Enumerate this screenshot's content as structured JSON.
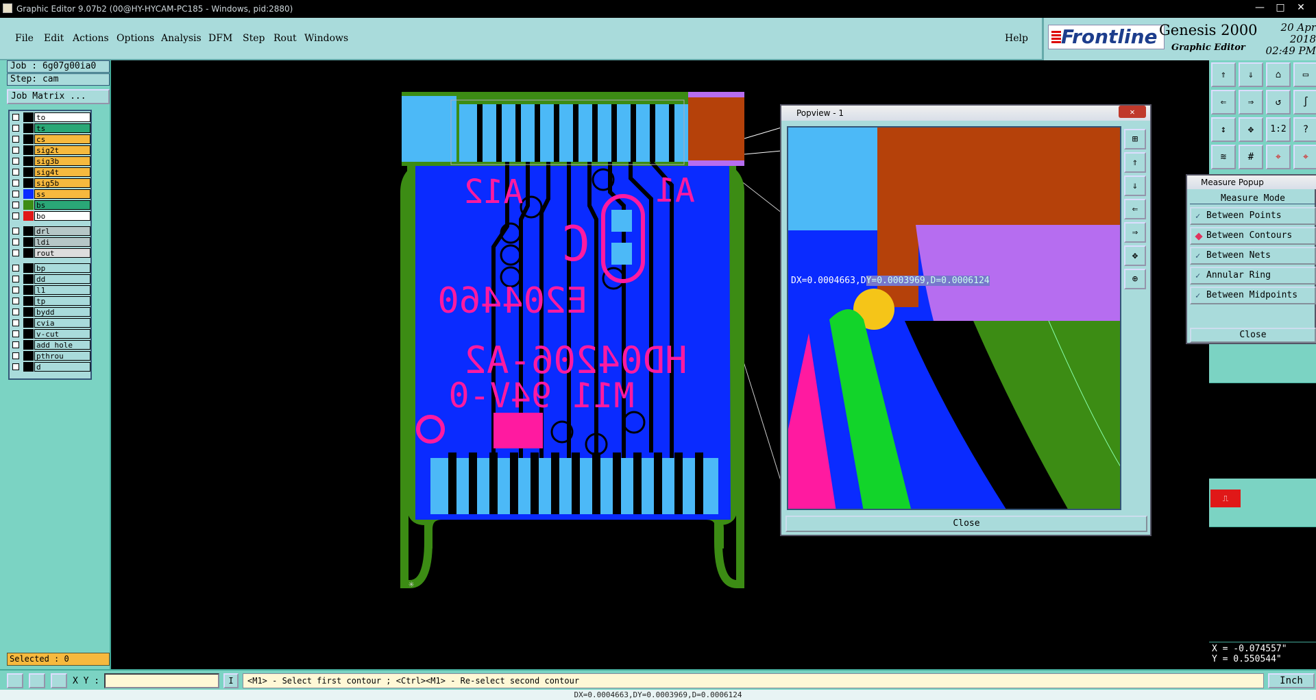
{
  "window": {
    "title": "Graphic Editor 9.07b2 (00@HY-HYCAM-PC185 - Windows, pid:2880)"
  },
  "menubar": {
    "items": [
      "File",
      "Edit",
      "Actions",
      "Options",
      "Analysis",
      "DFM",
      "Step",
      "Rout",
      "Windows"
    ],
    "help": "Help"
  },
  "brand": {
    "logo": "Frontline",
    "product": "Genesis 2000",
    "subtitle": "Graphic Editor",
    "date": "20 Apr 2018",
    "time": "02:49 PM"
  },
  "job": {
    "job": "Job : 6g07g00ia0",
    "step": "Step: cam",
    "matrix": "Job Matrix ..."
  },
  "layers": [
    {
      "name": "to",
      "color": "#ffffff"
    },
    {
      "name": "ts",
      "color": "#2aa877"
    },
    {
      "name": "cs",
      "color": "#f6b93e"
    },
    {
      "name": "sig2t",
      "color": "#f6b93e"
    },
    {
      "name": "sig3b",
      "color": "#f6b93e"
    },
    {
      "name": "sig4t",
      "color": "#f6b93e"
    },
    {
      "name": "sig5b",
      "color": "#f6b93e"
    },
    {
      "name": "ss",
      "color": "#f6b93e"
    },
    {
      "name": "bs",
      "color": "#2aa877"
    },
    {
      "name": "bo",
      "color": "#ffffff"
    },
    {
      "name": "drl",
      "color": "#b6c7c7"
    },
    {
      "name": "ldi",
      "color": "#b6c7c7"
    },
    {
      "name": "rout",
      "color": "#dddddd"
    },
    {
      "name": "bp",
      "color": "#a9dbdb"
    },
    {
      "name": "dd",
      "color": "#a9dbdb"
    },
    {
      "name": "l1",
      "color": "#a9dbdb"
    },
    {
      "name": "tp",
      "color": "#a9dbdb"
    },
    {
      "name": "bydd",
      "color": "#a9dbdb"
    },
    {
      "name": "cvia",
      "color": "#a9dbdb"
    },
    {
      "name": "v-cut",
      "color": "#a9dbdb"
    },
    {
      "name": "add_hole",
      "color": "#a9dbdb"
    },
    {
      "name": "pthrou",
      "color": "#a9dbdb"
    },
    {
      "name": "d",
      "color": "#a9dbdb"
    }
  ],
  "selected": "Selected : 0",
  "board_text": {
    "a12": "A12",
    "a1": "A1",
    "c": "C",
    "code1": "E204460",
    "code2": "HD04206-A2",
    "code3": "M11 94V-0"
  },
  "popview": {
    "title": "Popview - 1",
    "close": "Close",
    "measure_prefix": "DX=0.0004663,D",
    "measure_highlight": "Y=0.0003969,D=0.0006124"
  },
  "measure_popup": {
    "title": "Measure Popup",
    "mode_label": "Measure Mode",
    "options": [
      "Between Points",
      "Between Contours",
      "Between Nets",
      "Annular Ring",
      "Between Midpoints"
    ],
    "selected": "Between Contours",
    "close": "Close"
  },
  "coords": {
    "x": "X = -0.074557\"",
    "y": "Y = 0.550544\""
  },
  "statusbar": {
    "xy_label": "X Y :",
    "xy_value": "",
    "message": "<M1> - Select first contour ; <Ctrl><M1> - Re-select second contour",
    "unit": "Inch"
  },
  "bottom_text": "DX=0.0004663,DY=0.0003969,D=0.0006124",
  "colors": {
    "panel": "#7bd3c3",
    "light": "#a9dbdb",
    "board_blue": "#0a2bff",
    "copper": "#4cb9f7",
    "silk": "#ff1aa0",
    "rout": "#3c8c14"
  }
}
